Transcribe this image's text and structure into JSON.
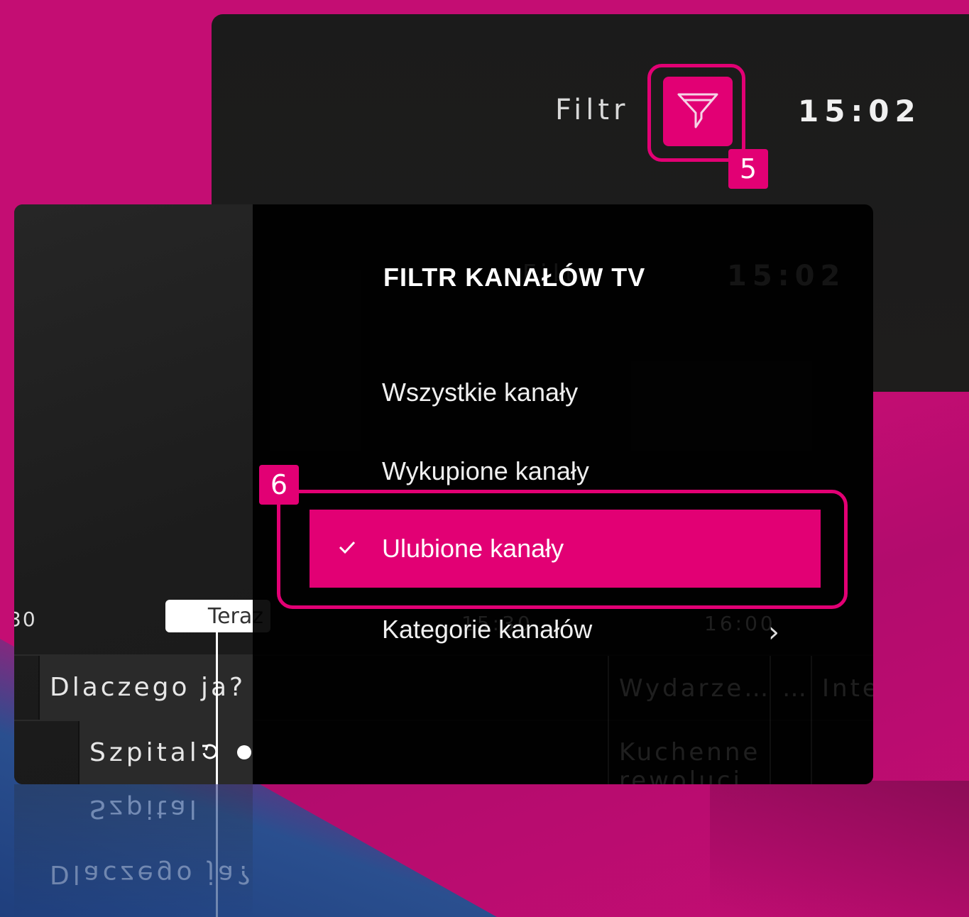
{
  "top_screen": {
    "filter_label": "Filtr",
    "clock": "15:02",
    "badge": "5"
  },
  "main_screen": {
    "timeline": {
      "left_time": "30",
      "now_label": "Teraz",
      "ghost_time_1": "15:30",
      "ghost_time_2": "16:00"
    },
    "programs": [
      {
        "title": "Dlaczego ja?"
      },
      {
        "title": "Szpital"
      }
    ],
    "ghost_programs": [
      "Wydarze…",
      "…",
      "Inte",
      "Kuchenne rewolucj"
    ],
    "ghost_header": {
      "filter_label": "Filtr",
      "clock": "15:02"
    }
  },
  "menu": {
    "title": "FILTR KANAŁÓW TV",
    "items": [
      {
        "label": "Wszystkie kanały",
        "selected": false
      },
      {
        "label": "Wykupione kanały",
        "selected": false
      },
      {
        "label": "Ulubione kanały",
        "selected": true
      },
      {
        "label": "Kategorie kanałów",
        "selected": false,
        "submenu": true
      }
    ],
    "badge": "6"
  },
  "colors": {
    "accent": "#e20074",
    "background": "#c40d73",
    "screen": "#1b1b1b"
  },
  "icons": [
    "filter-funnel-icon",
    "check-icon",
    "chevron-right-icon",
    "replay-icon",
    "record-dot-icon"
  ]
}
